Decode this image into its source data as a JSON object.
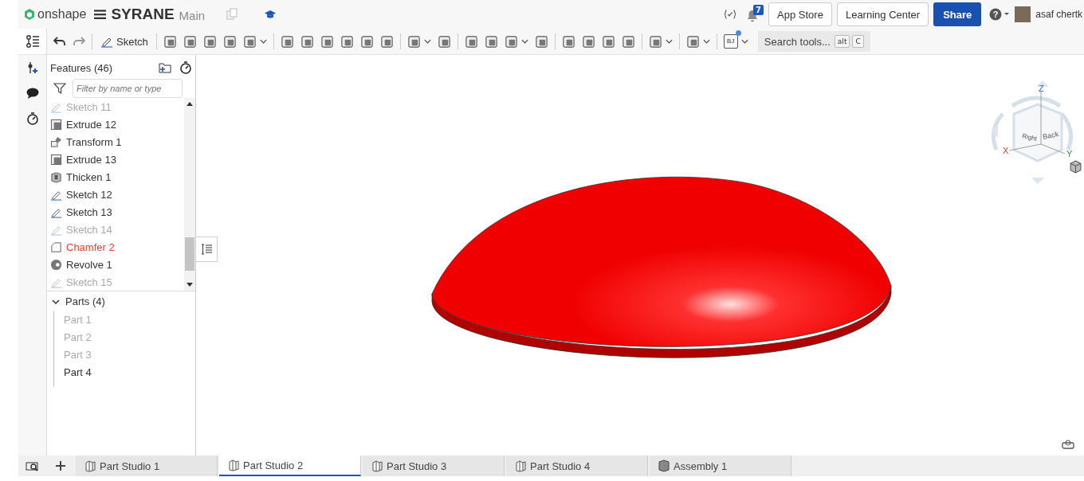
{
  "topbar": {
    "brand": "onshape",
    "document": "SYRANE",
    "branch": "Main",
    "notifications": "7",
    "buttons": [
      "App Store",
      "Learning Center"
    ],
    "share": "Share",
    "help": "?",
    "user": "asaf chertk"
  },
  "toolbar": {
    "sketch": "Sketch",
    "variable_badge": "BJ",
    "search": {
      "placeholder": "Search tools...",
      "keys": [
        "alt",
        "C"
      ]
    }
  },
  "features": {
    "title": "Features (46)",
    "filter": {
      "placeholder": "Filter by name or type"
    },
    "items": [
      {
        "kind": "sketch",
        "label": "Sketch 11",
        "suppressed": true,
        "error": false
      },
      {
        "kind": "extrude",
        "label": "Extrude 12",
        "suppressed": false,
        "error": false
      },
      {
        "kind": "transform",
        "label": "Transform 1",
        "suppressed": false,
        "error": false
      },
      {
        "kind": "extrude",
        "label": "Extrude 13",
        "suppressed": false,
        "error": false
      },
      {
        "kind": "thicken",
        "label": "Thicken 1",
        "suppressed": false,
        "error": false
      },
      {
        "kind": "sketch",
        "label": "Sketch 12",
        "suppressed": false,
        "error": false
      },
      {
        "kind": "sketch",
        "label": "Sketch 13",
        "suppressed": false,
        "error": false
      },
      {
        "kind": "sketch",
        "label": "Sketch 14",
        "suppressed": true,
        "error": false
      },
      {
        "kind": "chamfer",
        "label": "Chamfer 2",
        "suppressed": false,
        "error": true
      },
      {
        "kind": "revolve",
        "label": "Revolve 1",
        "suppressed": false,
        "error": false
      },
      {
        "kind": "sketch",
        "label": "Sketch 15",
        "suppressed": true,
        "error": false
      }
    ],
    "parts": {
      "title": "Parts (4)",
      "expanded": true,
      "items": [
        {
          "label": "Part 1",
          "hidden": true
        },
        {
          "label": "Part 2",
          "hidden": true
        },
        {
          "label": "Part 3",
          "hidden": true
        },
        {
          "label": "Part 4",
          "hidden": false
        }
      ]
    }
  },
  "viewcube": {
    "z": "Z",
    "x": "X",
    "y": "Y",
    "right": "Right",
    "back": "Back"
  },
  "tabs": [
    {
      "kind": "partstudio",
      "label": "Part Studio 1",
      "selected": false
    },
    {
      "kind": "partstudio",
      "label": "Part Studio 2",
      "selected": true
    },
    {
      "kind": "partstudio",
      "label": "Part Studio 3",
      "selected": false
    },
    {
      "kind": "partstudio",
      "label": "Part Studio 4",
      "selected": false
    },
    {
      "kind": "assembly",
      "label": "Assembly 1",
      "selected": false
    }
  ]
}
